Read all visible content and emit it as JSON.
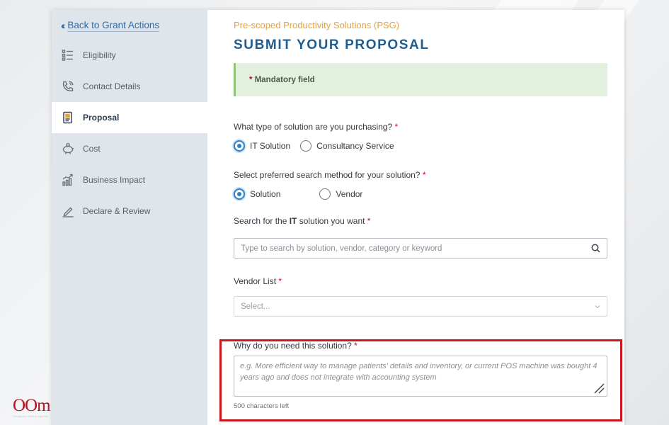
{
  "sidebar": {
    "back_label": "Back to Grant Actions",
    "items": [
      {
        "label": "Eligibility",
        "icon": "checklist-icon",
        "active": false
      },
      {
        "label": "Contact Details",
        "icon": "phone-icon",
        "active": false
      },
      {
        "label": "Proposal",
        "icon": "document-icon",
        "active": true
      },
      {
        "label": "Cost",
        "icon": "piggy-bank-icon",
        "active": false
      },
      {
        "label": "Business Impact",
        "icon": "bar-chart-icon",
        "active": false
      },
      {
        "label": "Declare & Review",
        "icon": "pen-icon",
        "active": false
      }
    ]
  },
  "main": {
    "scheme": "Pre-scoped Productivity Solutions (PSG)",
    "title": "SUBMIT YOUR PROPOSAL",
    "mandatory_note": "Mandatory field",
    "required_mark": "*",
    "q_solution_type": "What type of solution are you purchasing?",
    "solution_type_options": [
      "IT Solution",
      "Consultancy Service"
    ],
    "solution_type_selected": "IT Solution",
    "q_search_method": "Select preferred search method for your solution?",
    "search_method_options": [
      "Solution",
      "Vendor"
    ],
    "search_method_selected": "Solution",
    "q_search_prefix": "Search for the ",
    "q_search_bold": "IT",
    "q_search_suffix": " solution you want",
    "search_placeholder": "Type to search by solution, vendor, category or keyword",
    "q_vendor_list": "Vendor List",
    "vendor_placeholder": "Select...",
    "q_why": "Why do you need this solution?",
    "why_placeholder": "e.g. More efficient way to manage patients' details and inventory, or current POS machine was bought 4 years ago and does not integrate with accounting system",
    "chars_left": "500 characters left"
  },
  "logo": {
    "text": "OOm",
    "tagline": "Singapore Online Agency"
  },
  "colors": {
    "accent_blue": "#2f7fc4",
    "title_blue": "#1f5d8f",
    "scheme_orange": "#e8a13a",
    "required_red": "#d0021b",
    "highlight_red": "#c8181e",
    "mandatory_bg": "#e3f0de"
  }
}
